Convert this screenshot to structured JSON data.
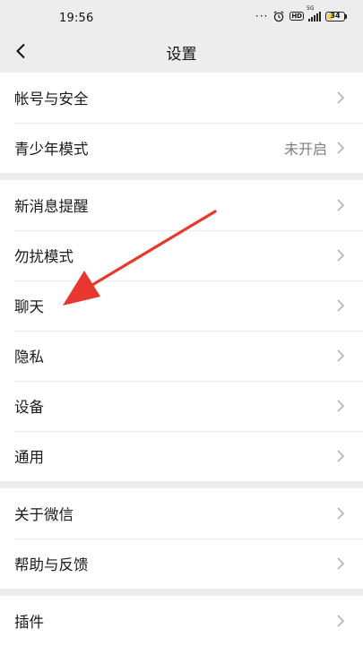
{
  "status": {
    "time": "19:56",
    "dots": "···",
    "hd": "HD",
    "network": "5G",
    "battery": "34",
    "battery_level": 0.34
  },
  "nav": {
    "title": "设置"
  },
  "groups": [
    {
      "items": [
        {
          "label": "帐号与安全"
        },
        {
          "label": "青少年模式",
          "value": "未开启"
        }
      ]
    },
    {
      "items": [
        {
          "label": "新消息提醒"
        },
        {
          "label": "勿扰模式"
        },
        {
          "label": "聊天"
        },
        {
          "label": "隐私"
        },
        {
          "label": "设备"
        },
        {
          "label": "通用"
        }
      ]
    },
    {
      "items": [
        {
          "label": "关于微信"
        },
        {
          "label": "帮助与反馈"
        }
      ]
    },
    {
      "items": [
        {
          "label": "插件"
        }
      ]
    }
  ],
  "colors": {
    "background": "#ededed",
    "annotation_arrow": "#e8372e",
    "battery_fill": "#f3d24d"
  }
}
